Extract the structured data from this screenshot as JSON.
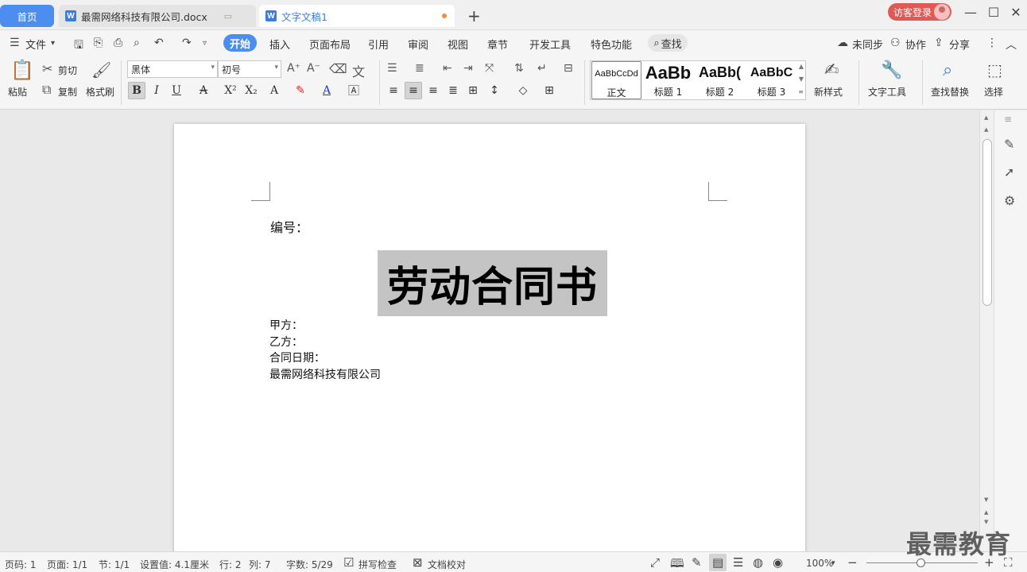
{
  "tabs": {
    "home": "首页",
    "doc1": "最需网络科技有限公司.docx",
    "doc2": "文字文稿1",
    "w_letter": "W"
  },
  "login": "访客登录",
  "menu": {
    "file": "文件",
    "tabs": [
      "开始",
      "插入",
      "页面布局",
      "引用",
      "审阅",
      "视图",
      "章节",
      "开发工具",
      "特色功能"
    ],
    "search": "查找",
    "unsynced": "未同步",
    "collab": "协作",
    "share": "分享"
  },
  "ribbon": {
    "paste": "粘贴",
    "cut": "剪切",
    "copy": "复制",
    "format_painter": "格式刷",
    "font_name": "黑体",
    "font_size": "初号",
    "styles": [
      {
        "sample": "AaBbCcDd",
        "name": "正文"
      },
      {
        "sample": "AaBb",
        "name": "标题 1"
      },
      {
        "sample": "AaBb(",
        "name": "标题 2"
      },
      {
        "sample": "AaBbC",
        "name": "标题 3"
      }
    ],
    "new_style": "新样式",
    "text_tools": "文字工具",
    "find_replace": "查找替换",
    "select": "选择"
  },
  "document": {
    "serial": "编号：",
    "title": "劳动合同书",
    "lines": [
      "甲方：",
      "乙方：",
      "合同日期：",
      "最需网络科技有限公司"
    ]
  },
  "status": {
    "page_no": "页码: 1",
    "pages": "页面: 1/1",
    "section": "节: 1/1",
    "setting": "设置值: 4.1厘米",
    "row": "行: 2",
    "col": "列: 7",
    "word_count": "字数: 5/29",
    "spell_check": "拼写检查",
    "doc_proof": "文档校对",
    "zoom": "100%",
    "zoom_level": 1.0
  },
  "watermark": "最需教育",
  "colors": {
    "accent": "#4b8ef0",
    "login": "#e05a55",
    "highlight": "#c4c4c4"
  }
}
